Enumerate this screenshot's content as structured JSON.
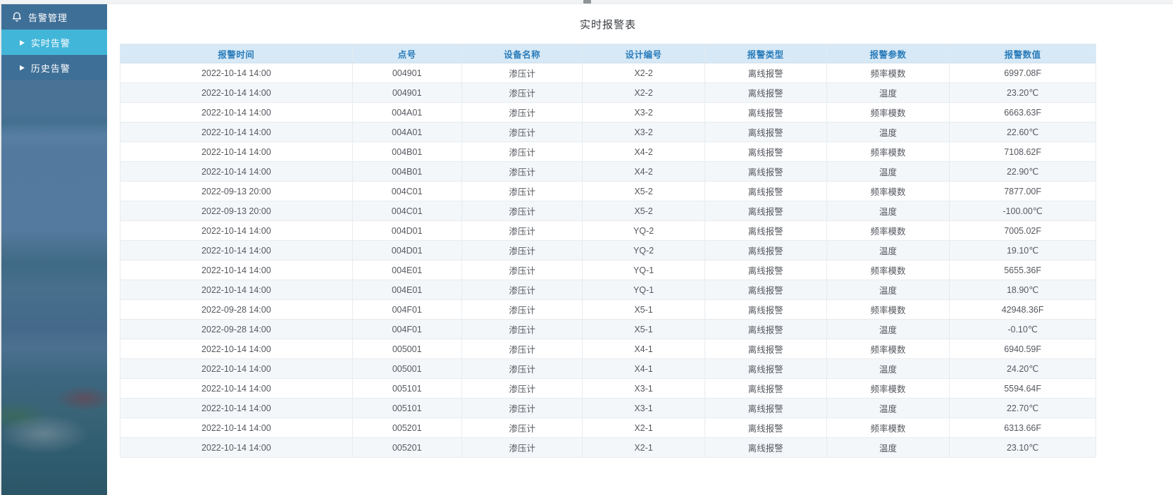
{
  "top_bar": {
    "handle_icon": "drag-handle"
  },
  "colors": {
    "sidebar_bg": "#3e6f97",
    "sidebar_active_bg": "#42b6d9",
    "table_header_bg": "#d7e9f6",
    "table_header_text": "#2a7cba",
    "row_alt_bg": "#f4f7fa",
    "body_text": "#55585e"
  },
  "icons": {
    "bell": "bell-outline",
    "arrow_glyph": "▶",
    "collapse_glyph": "◄"
  },
  "sidebar": {
    "items": [
      {
        "label": "告警管理",
        "icon": "bell-icon",
        "active": false
      },
      {
        "label": "实时告警",
        "icon": "arrow-right-icon",
        "active": true
      },
      {
        "label": "历史告警",
        "icon": "arrow-right-icon",
        "active": false
      }
    ]
  },
  "main": {
    "title": "实时报警表",
    "table": {
      "headers": [
        "报警时间",
        "点号",
        "设备名称",
        "设计编号",
        "报警类型",
        "报警参数",
        "报警数值"
      ],
      "rows": [
        [
          "2022-10-14 14:00",
          "004901",
          "渗压计",
          "X2-2",
          "离线报警",
          "频率模数",
          "6997.08F"
        ],
        [
          "2022-10-14 14:00",
          "004901",
          "渗压计",
          "X2-2",
          "离线报警",
          "温度",
          "23.20℃"
        ],
        [
          "2022-10-14 14:00",
          "004A01",
          "渗压计",
          "X3-2",
          "离线报警",
          "频率模数",
          "6663.63F"
        ],
        [
          "2022-10-14 14:00",
          "004A01",
          "渗压计",
          "X3-2",
          "离线报警",
          "温度",
          "22.60℃"
        ],
        [
          "2022-10-14 14:00",
          "004B01",
          "渗压计",
          "X4-2",
          "离线报警",
          "频率模数",
          "7108.62F"
        ],
        [
          "2022-10-14 14:00",
          "004B01",
          "渗压计",
          "X4-2",
          "离线报警",
          "温度",
          "22.90℃"
        ],
        [
          "2022-09-13 20:00",
          "004C01",
          "渗压计",
          "X5-2",
          "离线报警",
          "频率模数",
          "7877.00F"
        ],
        [
          "2022-09-13 20:00",
          "004C01",
          "渗压计",
          "X5-2",
          "离线报警",
          "温度",
          "-100.00℃"
        ],
        [
          "2022-10-14 14:00",
          "004D01",
          "渗压计",
          "YQ-2",
          "离线报警",
          "频率模数",
          "7005.02F"
        ],
        [
          "2022-10-14 14:00",
          "004D01",
          "渗压计",
          "YQ-2",
          "离线报警",
          "温度",
          "19.10℃"
        ],
        [
          "2022-10-14 14:00",
          "004E01",
          "渗压计",
          "YQ-1",
          "离线报警",
          "频率模数",
          "5655.36F"
        ],
        [
          "2022-10-14 14:00",
          "004E01",
          "渗压计",
          "YQ-1",
          "离线报警",
          "温度",
          "18.90℃"
        ],
        [
          "2022-09-28 14:00",
          "004F01",
          "渗压计",
          "X5-1",
          "离线报警",
          "频率模数",
          "42948.36F"
        ],
        [
          "2022-09-28 14:00",
          "004F01",
          "渗压计",
          "X5-1",
          "离线报警",
          "温度",
          "-0.10℃"
        ],
        [
          "2022-10-14 14:00",
          "005001",
          "渗压计",
          "X4-1",
          "离线报警",
          "频率模数",
          "6940.59F"
        ],
        [
          "2022-10-14 14:00",
          "005001",
          "渗压计",
          "X4-1",
          "离线报警",
          "温度",
          "24.20℃"
        ],
        [
          "2022-10-14 14:00",
          "005101",
          "渗压计",
          "X3-1",
          "离线报警",
          "频率模数",
          "5594.64F"
        ],
        [
          "2022-10-14 14:00",
          "005101",
          "渗压计",
          "X3-1",
          "离线报警",
          "温度",
          "22.70℃"
        ],
        [
          "2022-10-14 14:00",
          "005201",
          "渗压计",
          "X2-1",
          "离线报警",
          "频率模数",
          "6313.66F"
        ],
        [
          "2022-10-14 14:00",
          "005201",
          "渗压计",
          "X2-1",
          "离线报警",
          "温度",
          "23.10℃"
        ]
      ]
    }
  }
}
